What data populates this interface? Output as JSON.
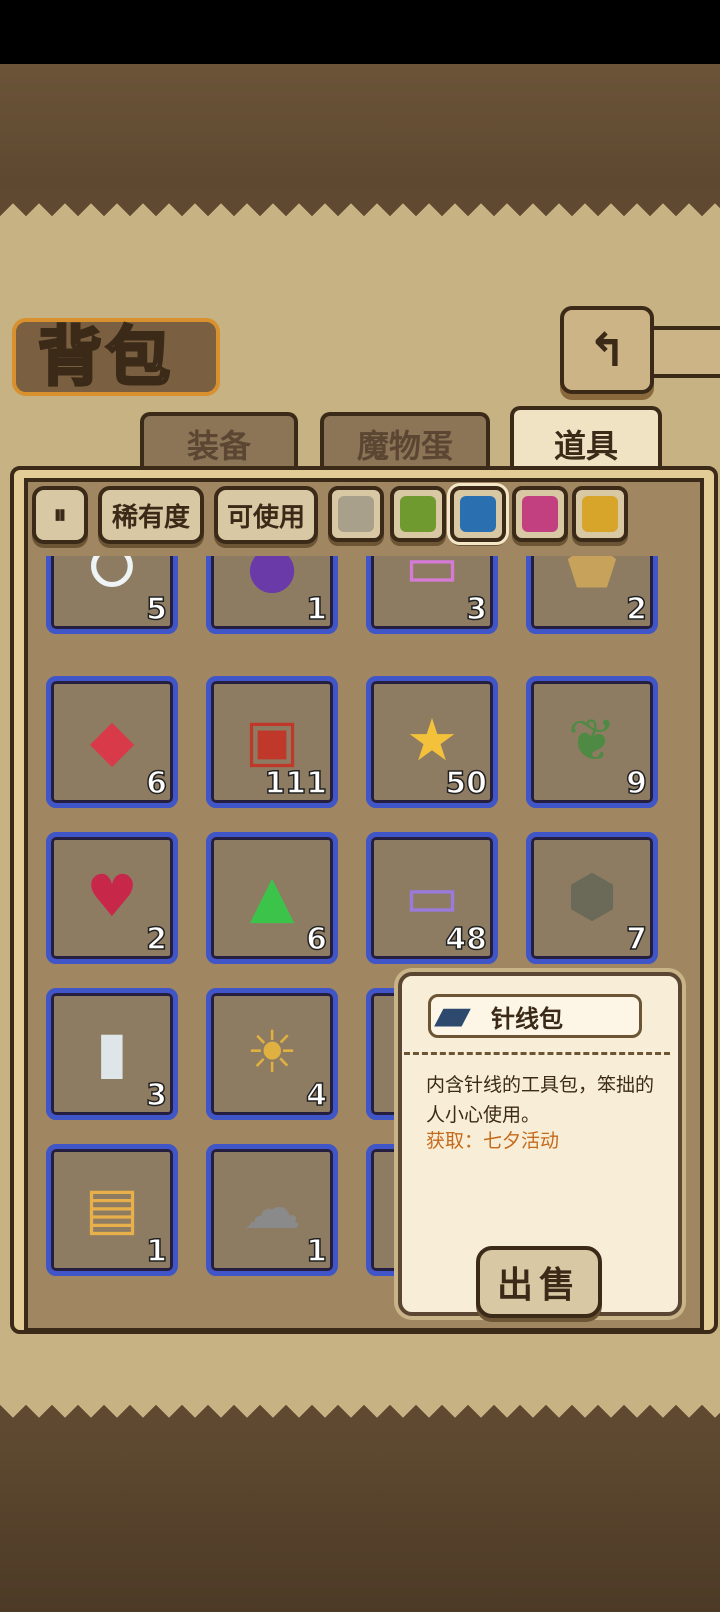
{
  "header": {
    "title": "背包",
    "back_icon": "back-arrow-icon"
  },
  "tabs": [
    {
      "label": "装备",
      "active": false
    },
    {
      "label": "魔物蛋",
      "active": false
    },
    {
      "label": "道具",
      "active": true
    }
  ],
  "filters": {
    "toggle_icon": "pause-bars-icon",
    "rarity_label": "稀有度",
    "usable_label": "可使用",
    "colors": [
      "#a9a08c",
      "#6f9a2f",
      "#2a6fb0",
      "#c2407f",
      "#d6a52a"
    ],
    "selected_color": "#2a6fb0"
  },
  "items": [
    {
      "name": "pearl-necklace",
      "icon": "pearl-necklace-icon",
      "glyph": "⭘",
      "tint": "#eef3f6",
      "count": "5"
    },
    {
      "name": "purple-coin",
      "icon": "purple-coin-icon",
      "glyph": "●",
      "tint": "#6a3aa8",
      "count": "1"
    },
    {
      "name": "purple-ticket",
      "icon": "ticket-icon",
      "glyph": "▭",
      "tint": "#d67ad8",
      "count": "3"
    },
    {
      "name": "gold-ore",
      "icon": "ore-icon",
      "glyph": "⬟",
      "tint": "#c6a25a",
      "count": "2"
    },
    {
      "name": "red-crystal",
      "icon": "crystal-icon",
      "glyph": "◆",
      "tint": "#d83a4a",
      "count": "6"
    },
    {
      "name": "treasure-chest",
      "icon": "chest-icon",
      "glyph": "▣",
      "tint": "#c0382a",
      "count": "111"
    },
    {
      "name": "star-ticket",
      "icon": "star-ticket-icon",
      "glyph": "★",
      "tint": "#f4c23a",
      "count": "50"
    },
    {
      "name": "herb-leaf",
      "icon": "leaf-icon",
      "glyph": "❦",
      "tint": "#4e8a44",
      "count": "9"
    },
    {
      "name": "red-goblet",
      "icon": "goblet-icon",
      "glyph": "♥",
      "tint": "#c7284a",
      "count": "2"
    },
    {
      "name": "green-gem",
      "icon": "gem-icon",
      "glyph": "▲",
      "tint": "#3cc34a",
      "count": "6"
    },
    {
      "name": "violet-ticket",
      "icon": "ticket-icon",
      "glyph": "▭",
      "tint": "#9b7ae0",
      "count": "48"
    },
    {
      "name": "stone-tablet",
      "icon": "stone-icon",
      "glyph": "⬢",
      "tint": "#6b6a58",
      "count": "7"
    },
    {
      "name": "message-bottle",
      "icon": "bottle-icon",
      "glyph": "▮",
      "tint": "#dfe6ea",
      "count": "3"
    },
    {
      "name": "sun-medal",
      "icon": "medal-icon",
      "glyph": "☀",
      "tint": "#e0b040",
      "count": "4"
    },
    {
      "name": "hidden-item-1",
      "icon": "item-icon",
      "glyph": "",
      "tint": "#8e7c62",
      "count": ""
    },
    {
      "name": "sewing-kit-cell",
      "icon": "item-icon",
      "glyph": "",
      "tint": "#8e7c62",
      "count": ""
    },
    {
      "name": "portrait-card",
      "icon": "portrait-card-icon",
      "glyph": "▤",
      "tint": "#e8b04a",
      "count": "1"
    },
    {
      "name": "grey-dust",
      "icon": "dust-pile-icon",
      "glyph": "☁",
      "tint": "#8a8a8a",
      "count": "1"
    },
    {
      "name": "hidden-item-2",
      "icon": "item-icon",
      "glyph": "",
      "tint": "#8e7c62",
      "count": ""
    },
    {
      "name": "hidden-item-3",
      "icon": "item-icon",
      "glyph": "",
      "tint": "#8e7c62",
      "count": ""
    }
  ],
  "tooltip": {
    "icon": "sewing-kit-icon",
    "name": "针线包",
    "description": "内含针线的工具包，笨拙的人小心使用。",
    "source": "获取：七夕活动",
    "sell_label": "出售"
  }
}
